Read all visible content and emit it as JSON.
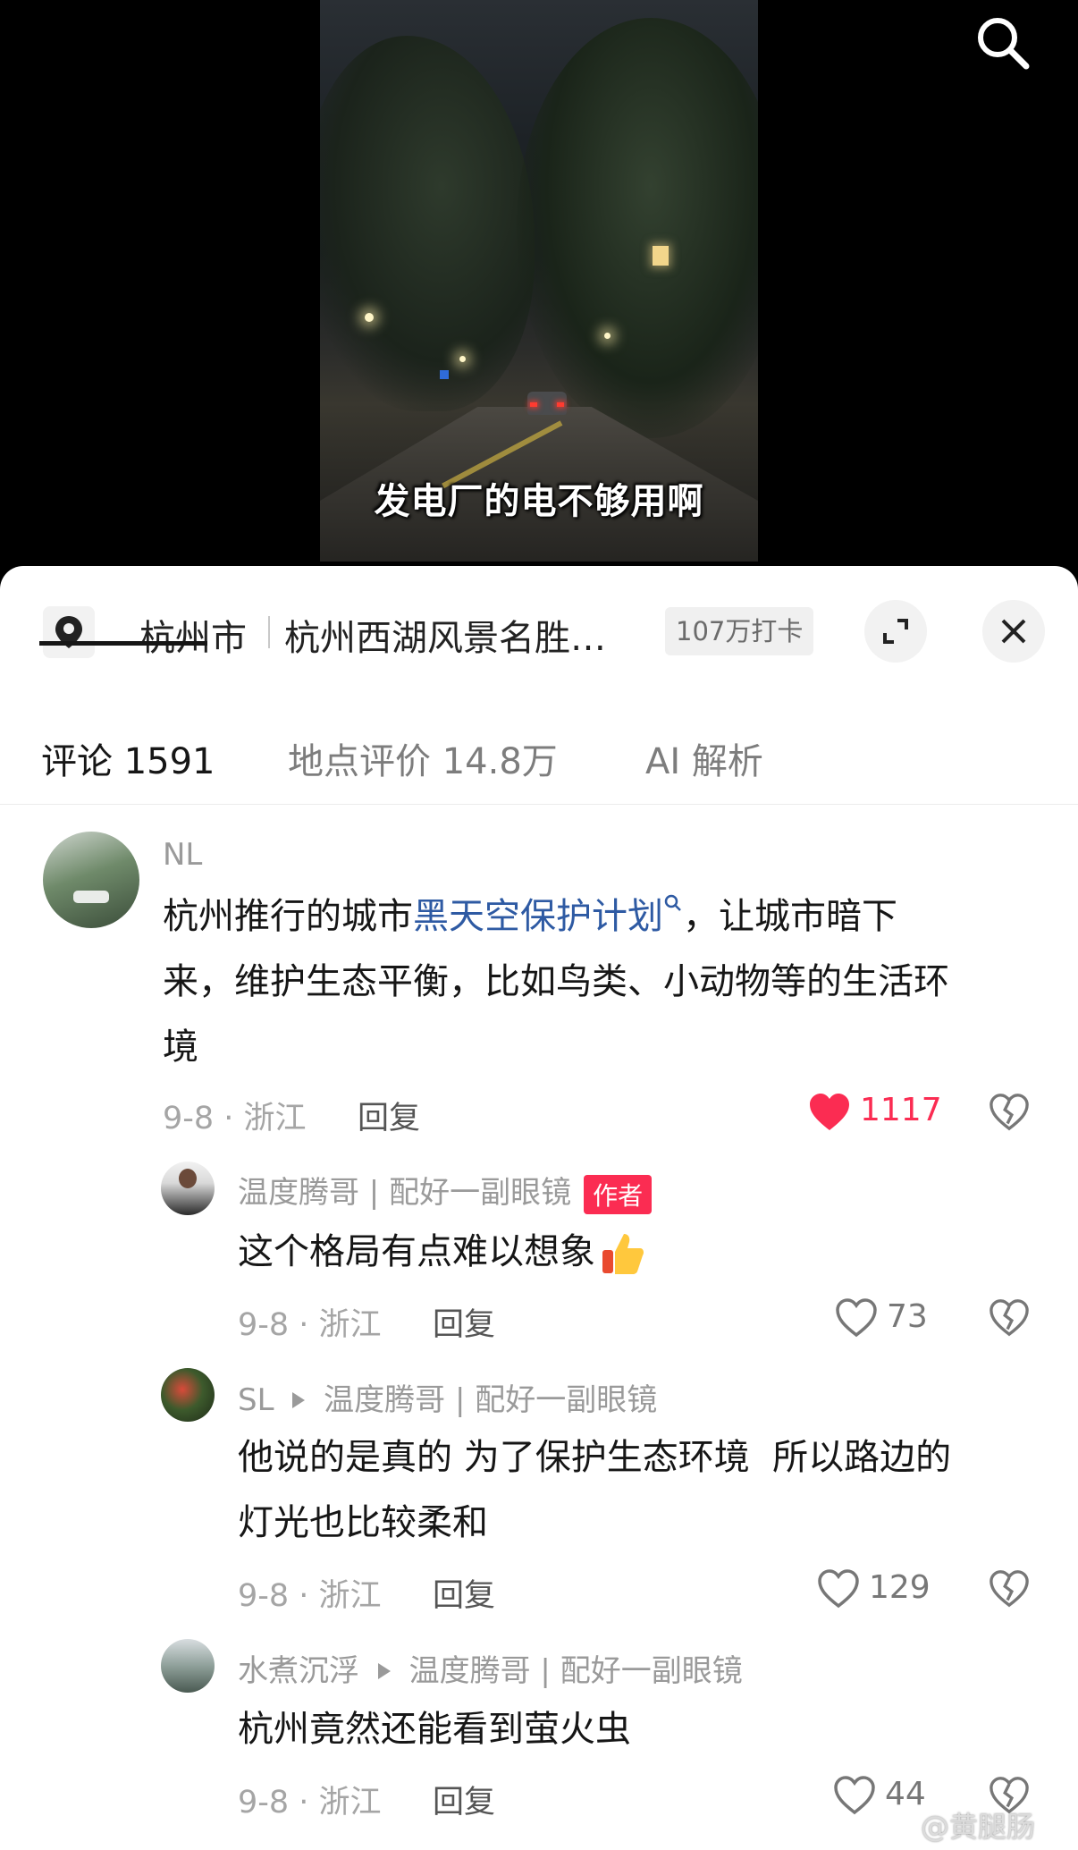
{
  "video": {
    "subtitle": "发电厂的电不够用啊"
  },
  "location": {
    "city": "杭州市",
    "place": "杭州西湖风景名胜…",
    "checkins": "107万打卡"
  },
  "tabs": [
    {
      "label": "评论 1591"
    },
    {
      "label": "地点评价 14.8万"
    },
    {
      "label": "AI 解析"
    }
  ],
  "comments": [
    {
      "user": "NL",
      "text_before": "杭州推行的城市",
      "link": "黑天空保护计划",
      "text_line1_after": "，让城市暗下",
      "text_line2": "来，维护生态平衡，比如鸟类、小动物等的生活环",
      "text_line3": "境",
      "meta": "9-8 · 浙江",
      "reply": "回复",
      "likes": "1117"
    },
    {
      "user": "温度腾哥 | 配好一副眼镜",
      "badge": "作者",
      "text": "这个格局有点难以想象",
      "meta": "9-8 · 浙江",
      "reply": "回复",
      "likes": "73"
    },
    {
      "user": "SL",
      "reply_to": "温度腾哥 | 配好一副眼镜",
      "text_line1": "他说的是真的 为了保护生态环境  所以路边的",
      "text_line2": "灯光也比较柔和",
      "meta": "9-8 · 浙江",
      "reply": "回复",
      "likes": "129"
    },
    {
      "user": "水煮沉浮",
      "reply_to": "温度腾哥 | 配好一副眼镜",
      "text": "杭州竟然还能看到萤火虫",
      "meta": "9-8 · 浙江",
      "reply": "回复",
      "likes": "44"
    }
  ],
  "watermark": "@黄腿肠",
  "colors": {
    "liked_red": "#fb2c52",
    "link_blue": "#2e5aa3"
  }
}
